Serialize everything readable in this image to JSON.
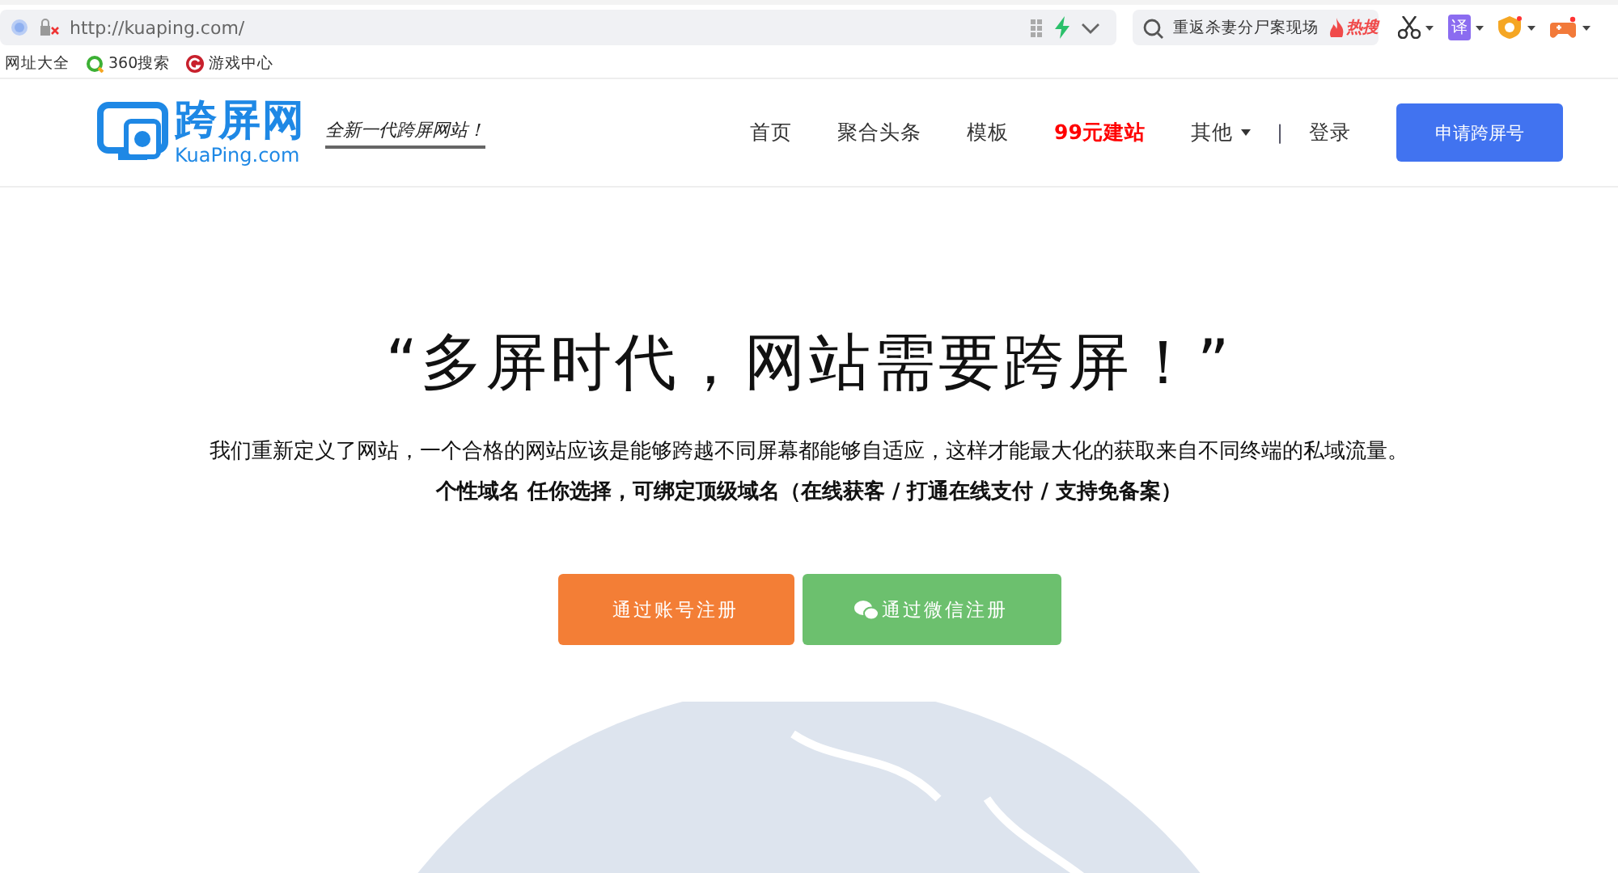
{
  "browser": {
    "address": "http://kuaping.com/",
    "search": {
      "value": "重返杀妻分尸案现场",
      "badge": "热搜"
    },
    "extensions": [
      {
        "kind": "scissors"
      },
      {
        "kind": "translate",
        "label": "译"
      },
      {
        "kind": "shield"
      },
      {
        "kind": "gamepad"
      }
    ],
    "bookmarks": [
      {
        "kind": "plain",
        "label": "网址大全"
      },
      {
        "kind": "search360",
        "label": "360搜索"
      },
      {
        "kind": "game",
        "label": "游戏中心"
      }
    ]
  },
  "header": {
    "logo": {
      "name": "跨屏网",
      "domain": "KuaPing.com",
      "slogan": "全新一代跨屏网站！"
    },
    "nav": [
      {
        "label": "首页",
        "kind": "link"
      },
      {
        "label": "聚合头条",
        "kind": "link"
      },
      {
        "label": "模板",
        "kind": "link"
      },
      {
        "label": "99元建站",
        "kind": "highlight"
      },
      {
        "label": "其他",
        "kind": "dropdown"
      }
    ],
    "separator": "|",
    "login": "登录",
    "cta": "申请跨屏号"
  },
  "hero": {
    "title": "“多屏时代，网站需要跨屏！”",
    "description": "我们重新定义了网站，一个合格的网站应该是能够跨越不同屏幕都能够自适应，这样才能最大化的获取来自不同终端的私域流量。",
    "features": "个性域名 任你选择，可绑定顶级域名（在线获客 / 打通在线支付 / 支持免备案）",
    "buttons": [
      {
        "label": "通过账号注册",
        "kind": "account"
      },
      {
        "label": "通过微信注册",
        "kind": "wechat"
      }
    ]
  }
}
